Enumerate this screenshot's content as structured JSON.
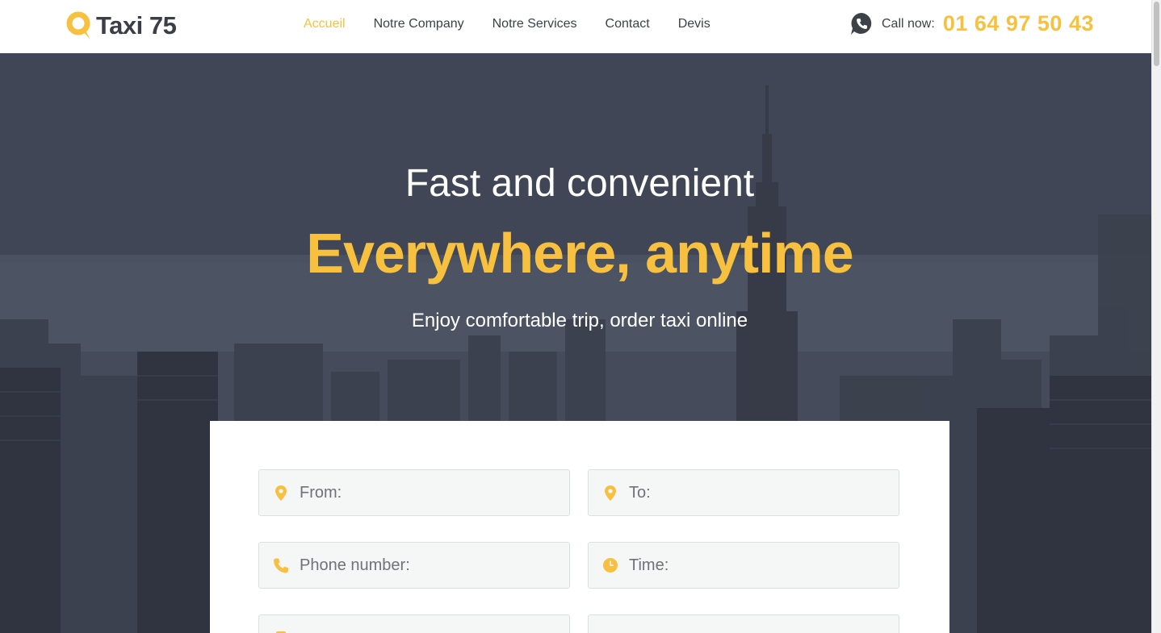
{
  "header": {
    "logo_text": "Taxi 75",
    "nav": [
      {
        "label": "Accueil",
        "active": true
      },
      {
        "label": "Notre Company",
        "active": false
      },
      {
        "label": "Notre Services",
        "active": false
      },
      {
        "label": "Contact",
        "active": false
      },
      {
        "label": "Devis",
        "active": false
      }
    ],
    "call_label": "Call now:",
    "call_number": "01 64 97 50 43"
  },
  "hero": {
    "title": "Fast and convenient",
    "headline": "Everywhere, anytime",
    "subtitle": "Enjoy comfortable trip, order taxi online"
  },
  "form": {
    "from_placeholder": "From:",
    "to_placeholder": "To:",
    "phone_placeholder": "Phone number:",
    "time_placeholder": "Time:",
    "field5_icon": "car-icon",
    "field6_icon": "card-icon"
  },
  "colors": {
    "accent": "#f7c13f",
    "text_dark": "#3d4148",
    "hero_overlay": "#3e4453"
  },
  "icons": {
    "logo": "location-pin-logo-icon",
    "call": "phone-chat-icon",
    "from": "map-pin-icon",
    "to": "map-pin-icon",
    "phone": "phone-icon",
    "time": "clock-icon"
  }
}
